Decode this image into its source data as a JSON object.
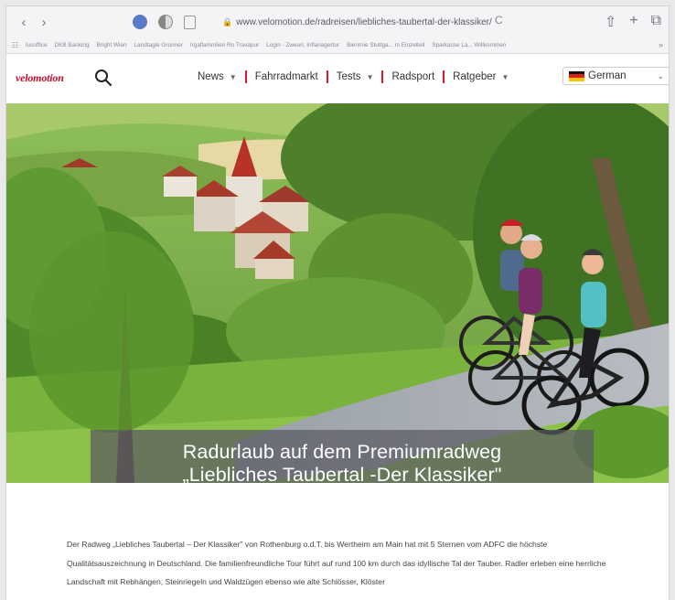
{
  "browser": {
    "back": "‹",
    "forward": "›",
    "url": "www.velomotion.de/radreisen/liebliches-taubertal-der-klassiker/",
    "reload": "C",
    "share": "⇧",
    "new_tab": "+",
    "tabs": "⧉",
    "favorites": [
      "lusoffice",
      "DKB Banking",
      "Bright Wien",
      "Landtagle Grunner",
      "Irgaflammlien Rn Travapur",
      "Login - Zweuri, Inflanagertur",
      "Bienrnie Stuttga... m Einzelteil",
      "Sparkasse La... Willkommen"
    ],
    "fav_more": "»"
  },
  "site": {
    "logo": "velomotion",
    "nav": [
      {
        "label": "News",
        "dropdown": true
      },
      {
        "label": "Fahrradmarkt",
        "dropdown": false
      },
      {
        "label": "Tests",
        "dropdown": true
      },
      {
        "label": "Radsport",
        "dropdown": false
      },
      {
        "label": "Ratgeber",
        "dropdown": true
      }
    ],
    "language": "German",
    "accent_color": "#e3142e"
  },
  "hero": {
    "title_line1": "Radurlaub auf dem Premiumradweg",
    "title_line2": "„Liebliches Taubertal -Der Klassiker\""
  },
  "article": {
    "paragraph": "Der Radweg „Liebliches Taubertal – Der Klassiker\" von Rothenburg o.d.T. bis Wertheim am Main hat mit 5 Sternen vom ADFC die höchste Qualitätsauszeichnung in Deutschland. Die familienfreundliche Tour führt auf rund 100 km durch das idyllische Tal der Tauber. Radler erleben eine herrliche Landschaft mit Rebhängen, Steinriegeln und Waldzügen ebenso wie alte Schlösser, Klöster"
  }
}
